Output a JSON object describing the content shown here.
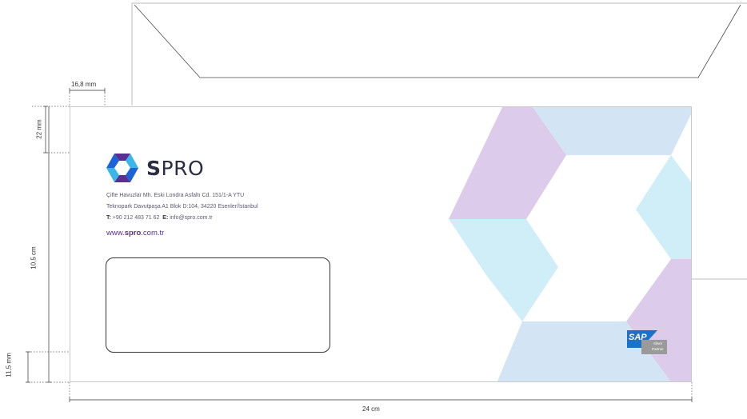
{
  "company": {
    "logo_text_bold": "S",
    "logo_text_rest": "PRO",
    "address_line1": "Çifte Havuzlar Mh. Eski Londra Asfaltı Cd. 151/1-A YTU",
    "address_line2": "Teknopark Davutpaşa A1 Blok D:104, 34220 Esenler/İstanbul",
    "phone_label": "T:",
    "phone": "+90 212 483 71 62",
    "email_label": "E:",
    "email": "info@spro.com.tr",
    "web_prefix": "www.",
    "web_bold": "spro",
    "web_suffix": ".com.tr"
  },
  "badge": {
    "brand": "SAP",
    "line1": "Silver",
    "line2": "Partner"
  },
  "dimensions": {
    "left_margin": "16,8 mm",
    "top_margin": "22 mm",
    "height": "10,5 cm",
    "bottom_margin": "11,5 mm",
    "width": "24 cm"
  },
  "colors": {
    "lavender": "#dccbea",
    "light_blue": "#d3e4f5",
    "light_cyan": "#cfeef7",
    "logo_blue": "#1e63d6",
    "logo_purple": "#5b2e91",
    "logo_cyan": "#3bb6e8"
  }
}
